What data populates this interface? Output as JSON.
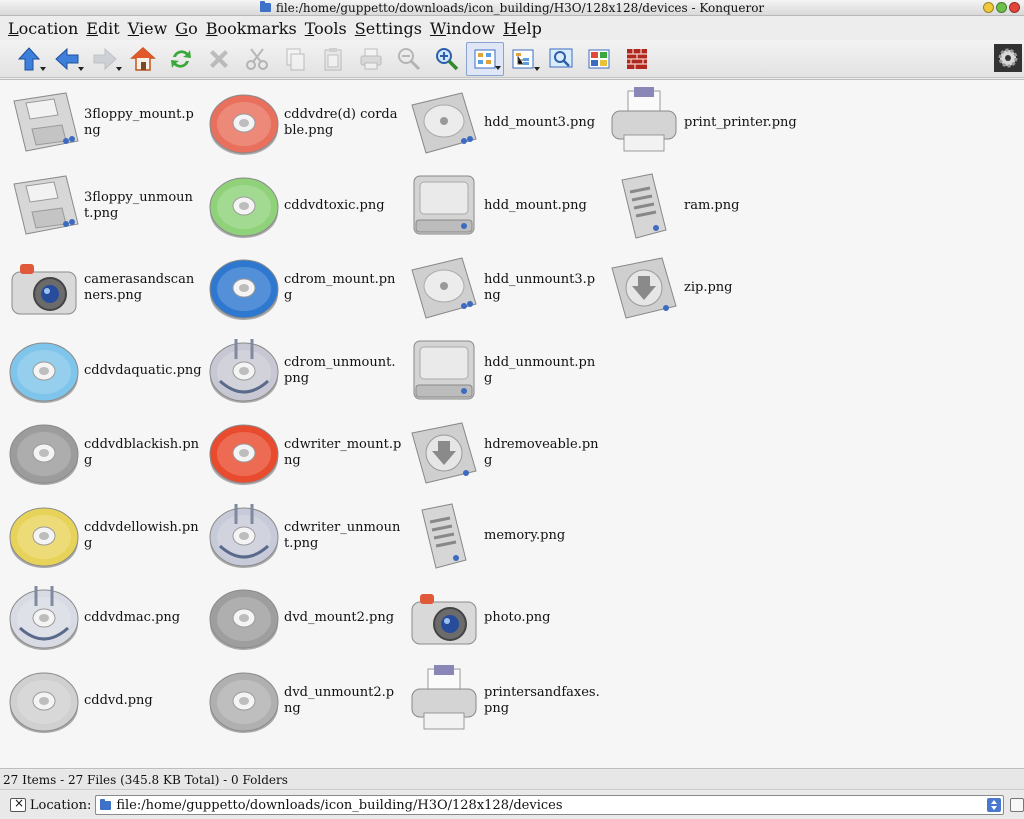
{
  "window": {
    "title": "file:/home/guppetto/downloads/icon_building/H3O/128x128/devices - Konqueror"
  },
  "menubar": {
    "items": [
      {
        "key": "L",
        "rest": "ocation"
      },
      {
        "key": "E",
        "rest": "dit"
      },
      {
        "key": "V",
        "rest": "iew"
      },
      {
        "key": "G",
        "rest": "o"
      },
      {
        "key": "B",
        "rest": "ookmarks"
      },
      {
        "key": "T",
        "rest": "ools"
      },
      {
        "key": "S",
        "rest": "ettings"
      },
      {
        "key": "W",
        "rest": "indow"
      },
      {
        "key": "H",
        "rest": "elp"
      }
    ]
  },
  "toolbar": {
    "icons": [
      "up-arrow-icon",
      "back-arrow-icon",
      "forward-arrow-icon",
      "home-icon",
      "reload-icon",
      "stop-icon",
      "cut-icon",
      "copy-icon",
      "paste-icon",
      "print-icon",
      "zoom-out-icon",
      "zoom-in-icon",
      "icon-view-icon",
      "tree-view-icon",
      "preview-icon",
      "multicolumn-view-icon",
      "firewall-icon"
    ]
  },
  "files": [
    {
      "name": "3floppy_mount.png",
      "kind": "floppy"
    },
    {
      "name": "3floppy_unmount.png",
      "kind": "floppy"
    },
    {
      "name": "camerasandscanners.png",
      "kind": "camera"
    },
    {
      "name": "cddvdaquatic.png",
      "kind": "disc",
      "color": "#7fc4ea"
    },
    {
      "name": "cddvdblackish.png",
      "kind": "disc",
      "color": "#9c9c9c"
    },
    {
      "name": "cddvdellowish.png",
      "kind": "disc",
      "color": "#e8d35a"
    },
    {
      "name": "cddvdmac.png",
      "kind": "discplug",
      "color": "#d8dbe4"
    },
    {
      "name": "cddvd.png",
      "kind": "disc",
      "color": "#d0d0d0"
    },
    {
      "name": "cddvdre(d) cordable.png",
      "kind": "disc",
      "color": "#e8705c"
    },
    {
      "name": "cddvdtoxic.png",
      "kind": "disc",
      "color": "#8fd27a"
    },
    {
      "name": "cdrom_mount.png",
      "kind": "disc",
      "color": "#2f78d0"
    },
    {
      "name": "cdrom_unmount.png",
      "kind": "discplug",
      "color": "#c8c8d4"
    },
    {
      "name": "cdwriter_mount.png",
      "kind": "disc",
      "color": "#e94b2e"
    },
    {
      "name": "cdwriter_unmount.png",
      "kind": "discplug",
      "color": "#c7cad8"
    },
    {
      "name": "dvd_mount2.png",
      "kind": "disc",
      "color": "#9e9e9e"
    },
    {
      "name": "dvd_unmount2.png",
      "kind": "disc",
      "color": "#b0b0b0"
    },
    {
      "name": "hdd_mount3.png",
      "kind": "hdd3"
    },
    {
      "name": "hdd_mount.png",
      "kind": "hdd"
    },
    {
      "name": "hdd_unmount3.png",
      "kind": "hdd3"
    },
    {
      "name": "hdd_unmount.png",
      "kind": "hdd"
    },
    {
      "name": "hdremoveable.png",
      "kind": "removable"
    },
    {
      "name": "memory.png",
      "kind": "memory"
    },
    {
      "name": "photo.png",
      "kind": "camera"
    },
    {
      "name": "printersandfaxes.png",
      "kind": "printer"
    },
    {
      "name": "print_printer.png",
      "kind": "printer"
    },
    {
      "name": "ram.png",
      "kind": "memory"
    },
    {
      "name": "zip.png",
      "kind": "removable"
    }
  ],
  "status": {
    "text": "27 Items - 27 Files (345.8 KB Total) - 0 Folders"
  },
  "location": {
    "label": "Location:",
    "value": "file:/home/guppetto/downloads/icon_building/H3O/128x128/devices"
  }
}
